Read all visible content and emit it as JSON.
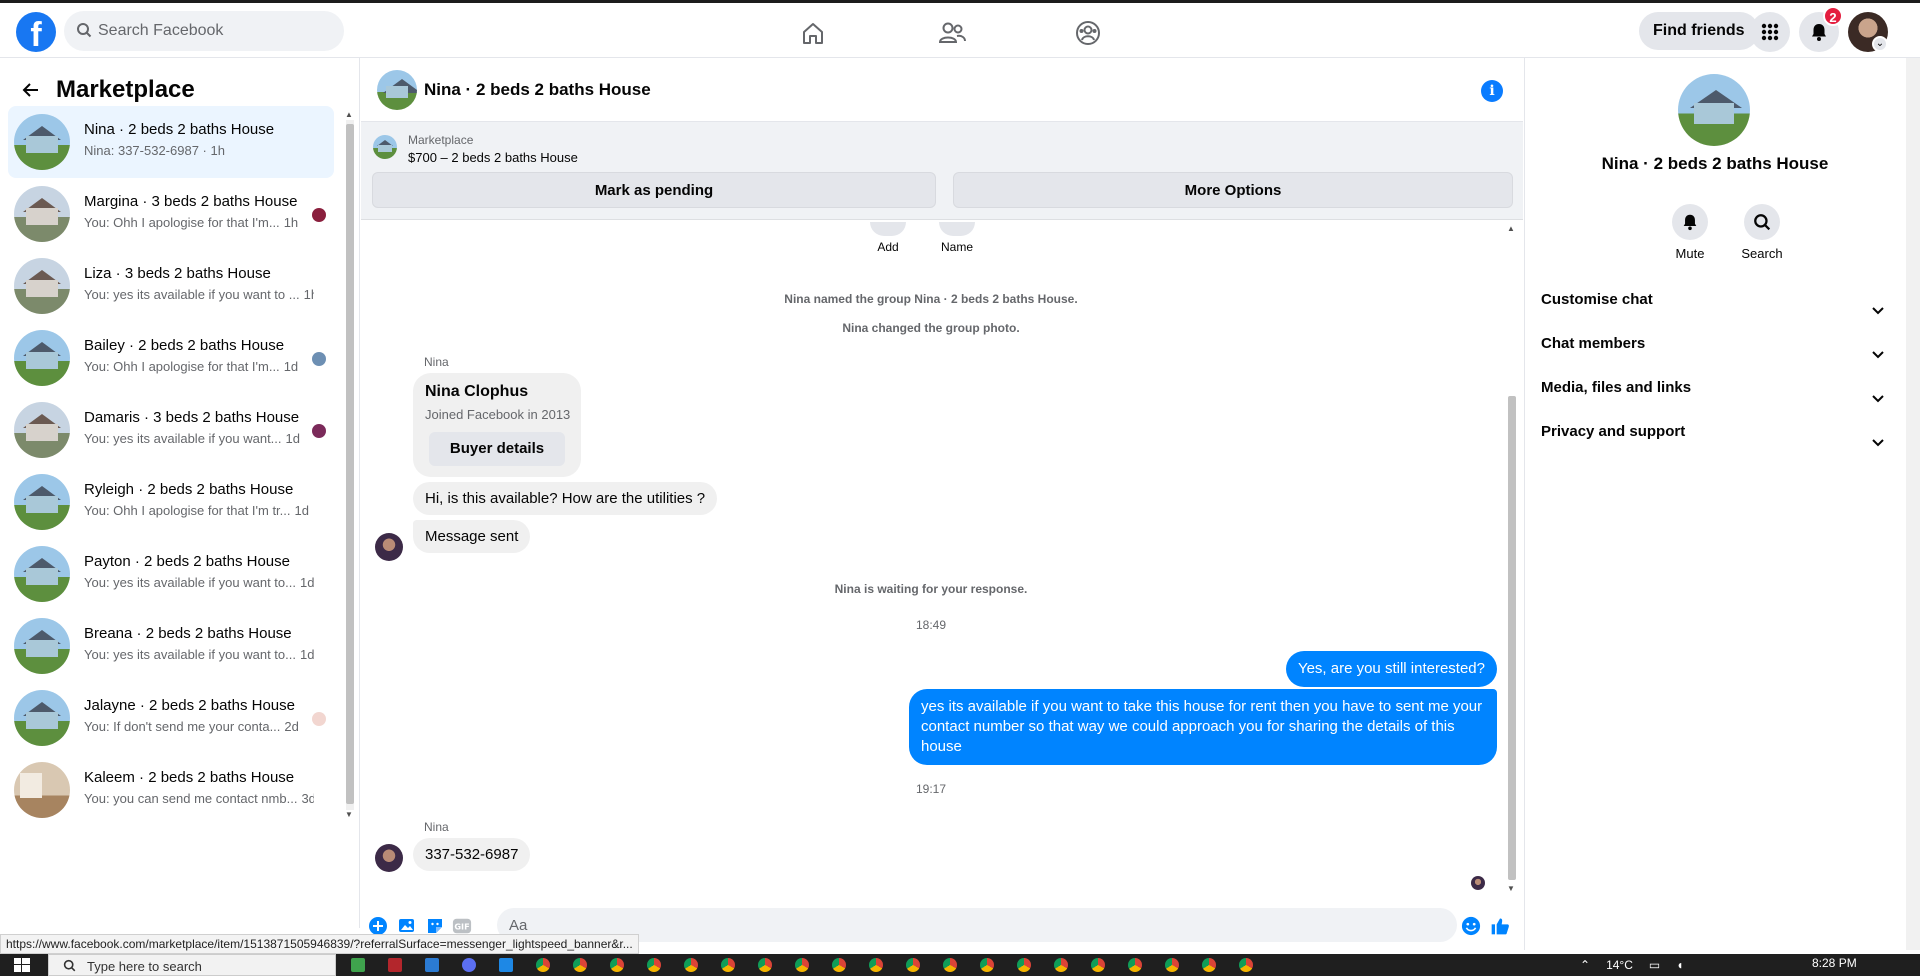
{
  "topbar": {
    "search_placeholder": "Search Facebook",
    "find_friends": "Find friends",
    "notification_count": "2",
    "nav_icons": [
      "home-icon",
      "friends-icon",
      "groups-icon"
    ]
  },
  "left": {
    "title": "Marketplace",
    "chats": [
      {
        "title": "Nina · 2 beds 2 baths House",
        "preview": "Nina: 337-532-6987 · 1h",
        "time": "",
        "thumb": "house-blue",
        "active": true,
        "seen": ""
      },
      {
        "title": "Margina · 3 beds 2 baths House",
        "preview": "You: Ohh I apologise for that I'm...",
        "time": "1h",
        "thumb": "house-grey",
        "active": false,
        "seen": "#8a1f3d"
      },
      {
        "title": "Liza · 3 beds 2 baths House",
        "preview": "You: yes its available if you want to ...",
        "time": "1h",
        "thumb": "house-grey",
        "active": false,
        "seen": ""
      },
      {
        "title": "Bailey · 2 beds 2 baths House",
        "preview": "You: Ohh I apologise for that I'm...",
        "time": "1d",
        "thumb": "house-blue",
        "active": false,
        "seen": "#6d8fb3"
      },
      {
        "title": "Damaris · 3 beds 2 baths House",
        "preview": "You: yes its available if you want...",
        "time": "1d",
        "thumb": "house-grey",
        "active": false,
        "seen": "#7b2a5a"
      },
      {
        "title": "Ryleigh · 2 beds 2 baths House",
        "preview": "You: Ohh I apologise for that I'm tr...",
        "time": "1d",
        "thumb": "house-blue",
        "active": false,
        "seen": ""
      },
      {
        "title": "Payton · 2 beds 2 baths House",
        "preview": "You: yes its available if you want to...",
        "time": "1d",
        "thumb": "house-blue",
        "active": false,
        "seen": ""
      },
      {
        "title": "Breana · 2 beds 2 baths House",
        "preview": "You: yes its available if you want to...",
        "time": "1d",
        "thumb": "house-blue",
        "active": false,
        "seen": ""
      },
      {
        "title": "Jalayne · 2 beds 2 baths House",
        "preview": "You: If don't send me your conta...",
        "time": "2d",
        "thumb": "house-blue",
        "active": false,
        "seen": "#f2d6d0"
      },
      {
        "title": "Kaleem · 2 beds 2 baths House",
        "preview": "You: you can send me contact nmb...",
        "time": "3d",
        "thumb": "room",
        "active": false,
        "seen": ""
      }
    ]
  },
  "chat": {
    "title": "Nina · 2 beds 2 baths House",
    "marketplace_label": "Marketplace",
    "price_line": "$700 – 2 beds 2 baths House",
    "mark_pending": "Mark as pending",
    "more_options": "More Options",
    "actions": [
      "Add",
      "Name"
    ],
    "sys_named": "Nina named the group Nina · 2 beds 2 baths House.",
    "sys_photo": "Nina changed the group photo.",
    "sender": "Nina",
    "card_name": "Nina Clophus",
    "card_joined": "Joined Facebook in 2013",
    "card_button": "Buyer details",
    "msg1": "Hi, is this available? How are the utilities ?",
    "msg2": "Message sent",
    "sys_waiting": "Nina is waiting for your response.",
    "time1": "18:49",
    "out1": "Yes, are you still interested?",
    "out2": "yes its available if you want to take this house for rent then you have to sent me your contact number so that way we could approach you for sharing the details of this house",
    "time2": "19:17",
    "sender2": "Nina",
    "msg3": "337-532-6987",
    "composer_placeholder": "Aa"
  },
  "right": {
    "title": "Nina · 2 beds 2 baths House",
    "mute": "Mute",
    "search": "Search",
    "rows": [
      "Customise chat",
      "Chat members",
      "Media, files and links",
      "Privacy and support"
    ]
  },
  "status_url": "https://www.facebook.com/marketplace/item/1513871505946839/?referralSurface=messenger_lightspeed_banner&r...",
  "taskbar": {
    "search_placeholder": "Type here to search",
    "weather": "14°C",
    "time": "8:28 PM"
  },
  "colors": {
    "brand": "#1877f2",
    "outgoing": "#0084ff",
    "badge": "#e41e3f"
  }
}
